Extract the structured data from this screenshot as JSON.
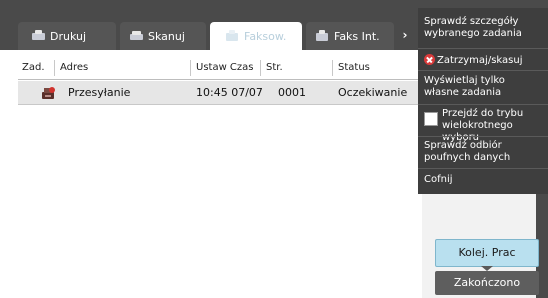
{
  "tabs": [
    {
      "label": "Drukuj",
      "icon": "print-icon",
      "active": false
    },
    {
      "label": "Skanuj",
      "icon": "scan-icon",
      "active": false
    },
    {
      "label": "Faksow.",
      "icon": "fax-icon",
      "active": true
    },
    {
      "label": "Faks Int.",
      "icon": "internet-fax-icon",
      "active": false
    }
  ],
  "table": {
    "headers": [
      "Zad.",
      "Adres",
      "Ustaw Czas",
      "Str.",
      "Status"
    ],
    "rows": [
      {
        "icon": "sending-icon",
        "address": "Przesyłanie",
        "time": "10:45 07/07",
        "pages": "0001",
        "status": "Oczekiwanie"
      }
    ]
  },
  "menu": {
    "items": [
      "Sprawdź szczegóły wybranego zadania",
      "Zatrzymaj/skasuj",
      "Wyświetlaj tylko własne zadania",
      "Przejdź do trybu wielokrotnego wyboru",
      "Sprawdź odbiór poufnych danych",
      "Cofnij"
    ]
  },
  "buttons": {
    "queue": "Kolej. Prac",
    "completed": "Zakończono"
  },
  "colors": {
    "header_dark": "#4a4a4a",
    "menu_bg": "#3e3e3e",
    "queue_button": "#b9e0ef",
    "completed_button": "#5e5e5e",
    "active_tab_text": "#b8cfdc",
    "stop_icon": "#d93a3a"
  }
}
